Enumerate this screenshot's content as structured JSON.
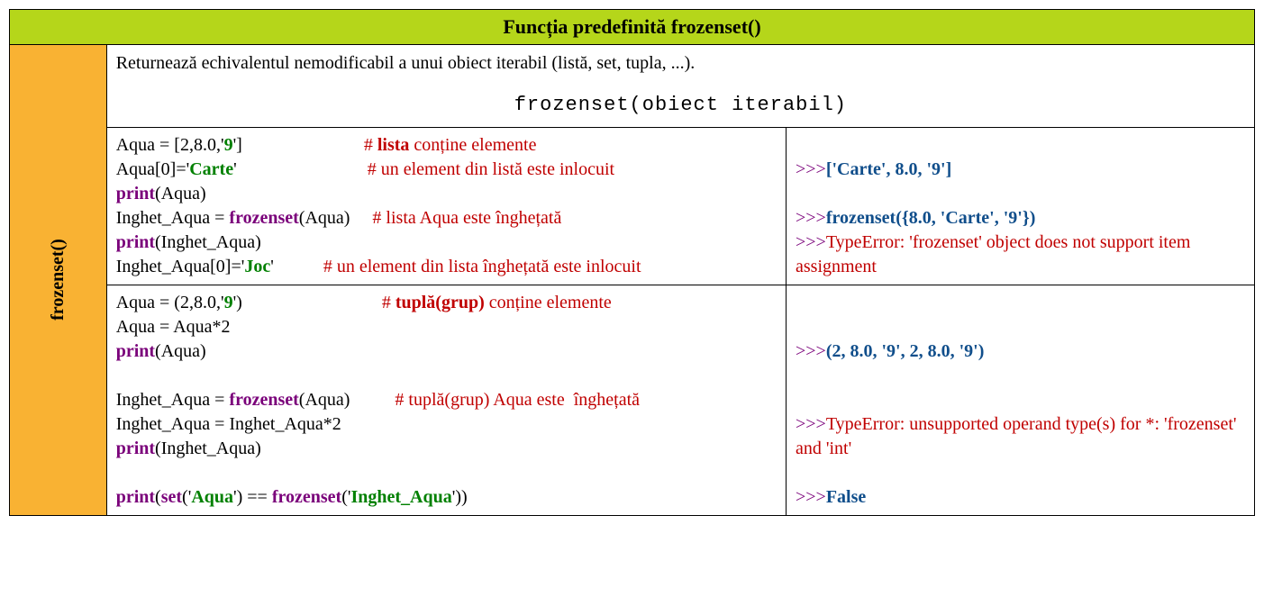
{
  "title": "Funcția predefinită frozenset()",
  "side_label": "frozenset()",
  "desc": "Returnează echivalentul nemodificabil a unui obiect iterabil (listă, set, tupla, ...).",
  "syntax": "frozenset(obiect iterabil)",
  "ex1": {
    "l1a": "Aqua = [2,8.0,'",
    "l1b": "9",
    "l1c": "']",
    "c1a": "# ",
    "c1b": "lista",
    "c1c": " conține elemente",
    "l2a": "Aqua[0]='",
    "l2b": "Carte",
    "l2c": "'",
    "c2": "# un element din listă este inlocuit",
    "l3a": "print",
    "l3b": "(Aqua)",
    "l4a": "Inghet_Aqua = ",
    "l4b": "frozenset",
    "l4c": "(Aqua)",
    "c4": "# lista Aqua este înghețată",
    "l5a": "print",
    "l5b": "(Inghet_Aqua)",
    "l6a": "Inghet_Aqua[0]='",
    "l6b": "Joc",
    "l6c": "'",
    "c6": "# un element din lista înghețată este inlocuit"
  },
  "out1": {
    "p": ">>>",
    "o1": "['Carte', 8.0, '9']",
    "o2": "frozenset({8.0, 'Carte', '9'})",
    "e1": "TypeError: 'frozenset' object does not support item assignment"
  },
  "ex2": {
    "l1a": "Aqua = (2,8.0,'",
    "l1b": "9",
    "l1c": "')",
    "c1a": "# ",
    "c1b": "tuplă(grup)",
    "c1c": " conține elemente",
    "l2": "Aqua = Aqua*2",
    "l3a": "print",
    "l3b": "(Aqua)",
    "l4a": "Inghet_Aqua = ",
    "l4b": "frozenset",
    "l4c": "(Aqua)",
    "c4": "# tuplă(grup) Aqua este  înghețată",
    "l5": "Inghet_Aqua = Inghet_Aqua*2",
    "l6a": "print",
    "l6b": "(Inghet_Aqua)",
    "l7a": "print",
    "l7b": "(",
    "l7c": "set",
    "l7d": "('",
    "l7e": "Aqua",
    "l7f": "') == ",
    "l7g": "frozenset",
    "l7h": "('",
    "l7i": "Inghet_Aqua",
    "l7j": "'))"
  },
  "out2": {
    "p": ">>>",
    "o1": "(2, 8.0, '9', 2, 8.0, '9')",
    "e1": "TypeError: unsupported operand type(s) for *: 'frozenset' and 'int'",
    "o2": "False"
  }
}
